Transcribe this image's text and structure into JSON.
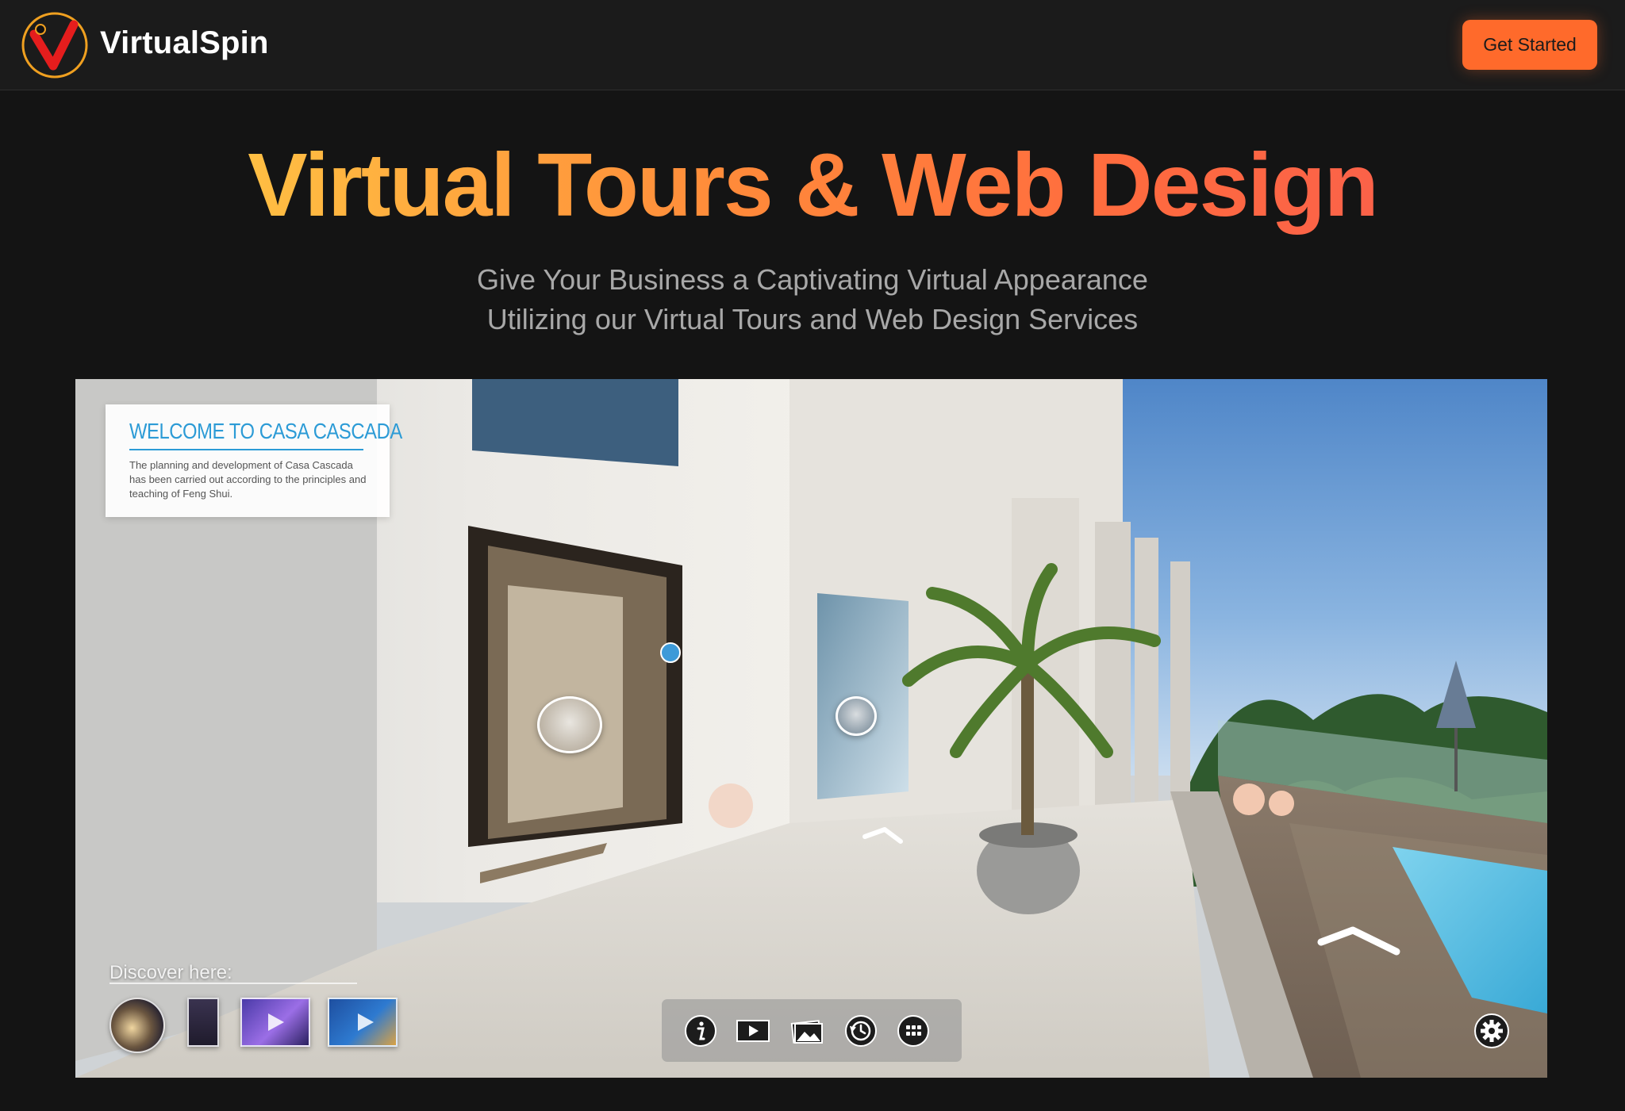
{
  "header": {
    "brand": "VirtualSpin",
    "cta_label": "Get Started",
    "logo_icon": "virtualspin-logo-icon"
  },
  "hero": {
    "title": "Virtual Tours & Web Design",
    "subtitle_line1": "Give Your Business a Captivating Virtual Appearance",
    "subtitle_line2": "Utilizing our Virtual Tours and Web Design Services"
  },
  "tour": {
    "welcome_title": "WELCOME TO CASA CASCADA",
    "welcome_text": "The planning and development of Casa Cascada has been carried out according to the principles and teaching of Feng Shui.",
    "discover_label": "Discover here:",
    "thumbnails": [
      "night-courtyard-thumb",
      "dark-room-thumb",
      "pool-video-thumb",
      "terrace-video-thumb"
    ],
    "toolbar_icons": [
      "info-icon",
      "play-icon",
      "gallery-icon",
      "history-icon",
      "grid-icon"
    ],
    "settings_icon": "gear-icon"
  },
  "colors": {
    "background": "#141414",
    "header": "#1b1b1b",
    "accent": "#ff6a2b",
    "title_gradient_start": "#ffd84a",
    "title_gradient_end": "#f65a53",
    "welcome_blue": "#2c9bd6"
  }
}
